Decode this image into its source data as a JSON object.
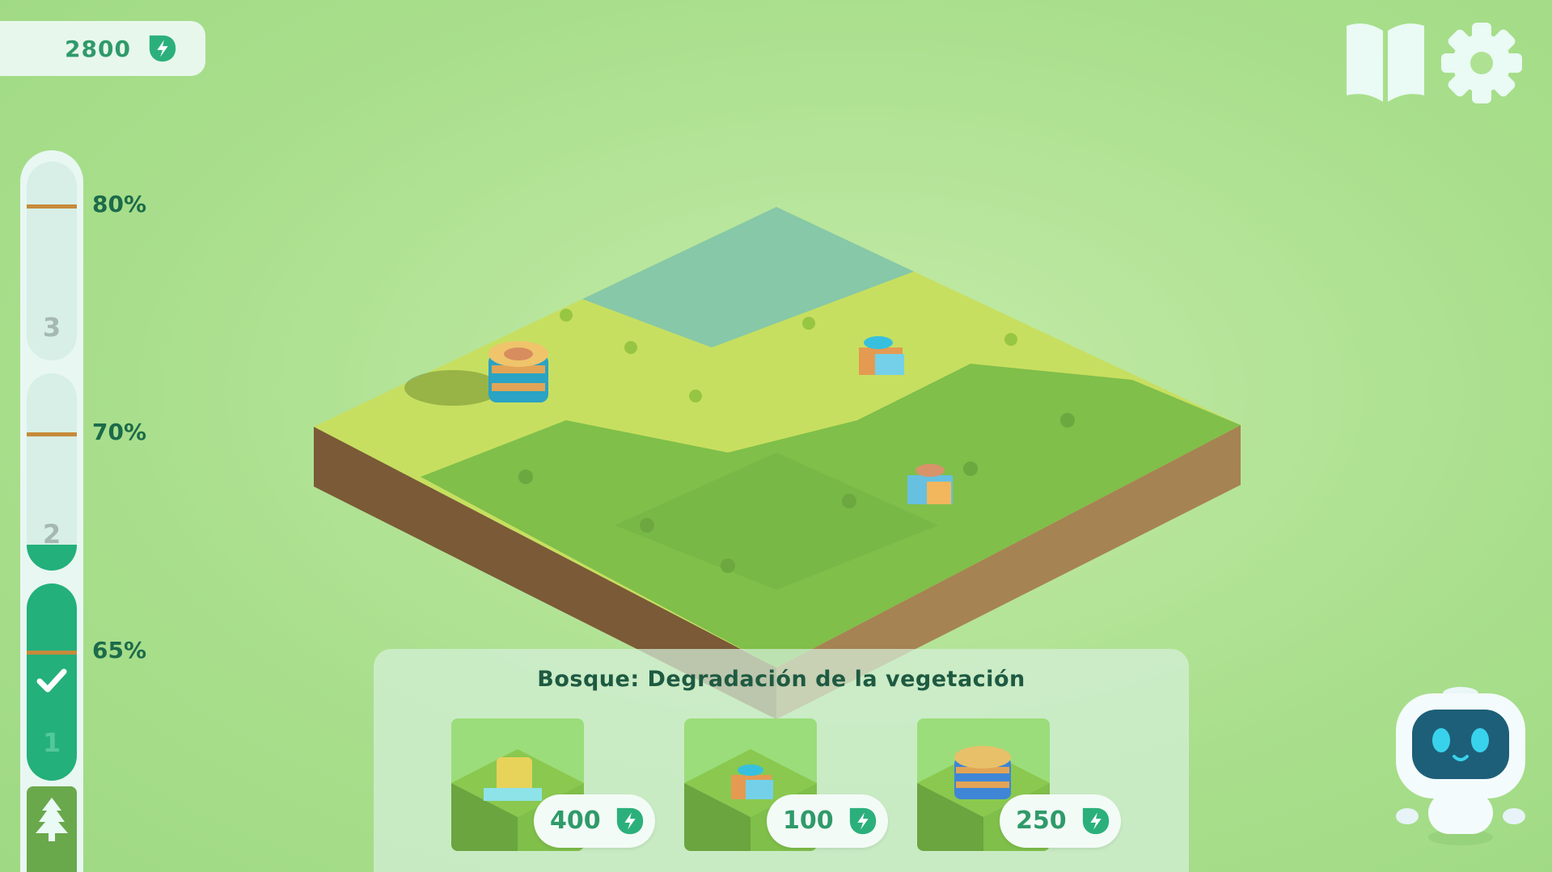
{
  "hud": {
    "energy": "2800",
    "icons": {
      "energy": "leaf-bolt-icon",
      "guide": "book-icon",
      "settings": "gear-icon"
    }
  },
  "progress": {
    "thresholds": [
      "80%",
      "70%",
      "65%"
    ],
    "levels": [
      {
        "number": "3",
        "fill": 0
      },
      {
        "number": "2",
        "fill": 0.13
      },
      {
        "number": "1",
        "fill": 1,
        "completed": true
      }
    ],
    "biome_icon": "pine-tree-icon"
  },
  "panel": {
    "title": "Bosque: Degradación de la vegetación",
    "items": [
      {
        "price": "400",
        "icon": "solar-machine-icon"
      },
      {
        "price": "100",
        "icon": "seed-dispenser-robot-icon"
      },
      {
        "price": "250",
        "icon": "water-tank-icon"
      }
    ]
  },
  "colors": {
    "accent": "#23b07b",
    "text_dark": "#1e5a42",
    "tick": "#c68a3a",
    "background": "#aee292"
  },
  "assistant": {
    "icon": "robot-assistant-icon"
  }
}
